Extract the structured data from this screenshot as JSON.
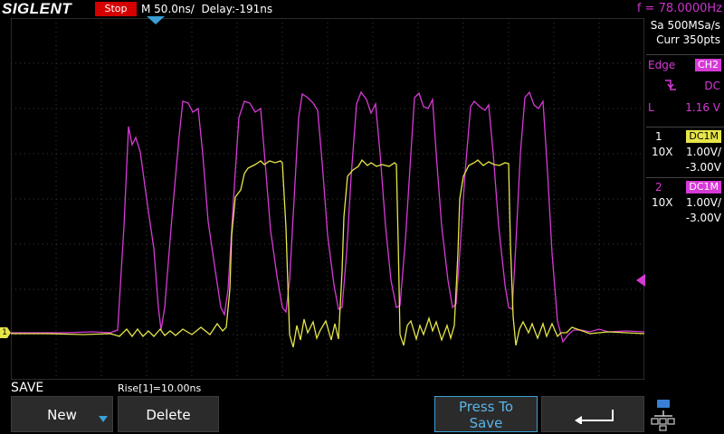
{
  "header": {
    "brand": "SIGLENT",
    "status": "Stop",
    "timebase": "M 50.0ns/",
    "delay": "Delay:-191ns",
    "frequency": "f = 78.0000Hz"
  },
  "acquisition": {
    "sample_rate": "Sa 500MSa/s",
    "memory": "Curr 350pts"
  },
  "trigger": {
    "type": "Edge",
    "source": "CH2",
    "coupling": "DC",
    "level_label": "L",
    "level": "1.16 V"
  },
  "channels": [
    {
      "number": "1",
      "coupling": "DC1M",
      "probe": "10X",
      "scale": "1.00V/",
      "offset": "-3.00V",
      "color": "#e8e84a"
    },
    {
      "number": "2",
      "coupling": "DC1M",
      "probe": "10X",
      "scale": "1.00V/",
      "offset": "-3.00V",
      "color": "#e02ee0"
    }
  ],
  "markers": {
    "ch1": "1"
  },
  "footer": {
    "menu_title": "SAVE",
    "measurement": "Rise[1]=10.00ns",
    "softkeys": {
      "new": "New",
      "delete": "Delete",
      "press_line1": "Press To",
      "press_line2": "Save"
    }
  },
  "icons": {
    "trigger_edge": "falling-edge-icon",
    "back": "return-arrow-icon",
    "network": "network-icon",
    "new_dropdown": "chevron-down-icon"
  }
}
